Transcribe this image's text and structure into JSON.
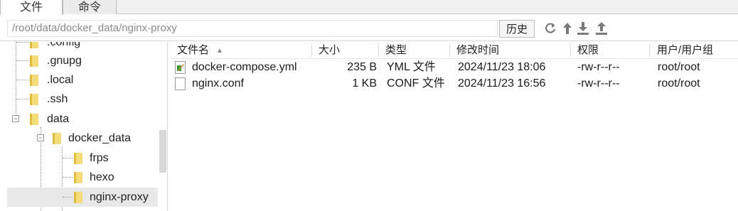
{
  "tabs": [
    {
      "label": "文件",
      "active": true
    },
    {
      "label": "命令",
      "active": false
    }
  ],
  "pathbar": {
    "path": "/root/data/docker_data/nginx-proxy",
    "history_label": "历史"
  },
  "toolbar_icons": [
    "refresh-icon",
    "up-directory-icon",
    "download-icon",
    "upload-icon"
  ],
  "tree": {
    "items": [
      {
        "label": ".config"
      },
      {
        "label": ".gnupg"
      },
      {
        "label": ".local"
      },
      {
        "label": ".ssh"
      },
      {
        "label": "data",
        "expanded": true
      },
      {
        "label": "docker_data",
        "expanded": true
      },
      {
        "label": "frps"
      },
      {
        "label": "hexo"
      },
      {
        "label": "nginx-proxy",
        "selected": true
      }
    ]
  },
  "filelist": {
    "columns": [
      "文件名",
      "大小",
      "类型",
      "修改时间",
      "权限",
      "用户/用户组"
    ],
    "rows": [
      {
        "name": "docker-compose.yml",
        "size": "235 B",
        "type": "YML 文件",
        "modified": "2024/11/23 18:06",
        "perms": "-rw-r--r--",
        "owner": "root/root",
        "icon": "yml-file-icon"
      },
      {
        "name": "nginx.conf",
        "size": "1 KB",
        "type": "CONF 文件",
        "modified": "2024/11/23 16:56",
        "perms": "-rw-r--r--",
        "owner": "root/root",
        "icon": "conf-file-icon"
      }
    ]
  },
  "colors": {
    "folder": "#f4dc7a",
    "selection": "#e8e8e8",
    "path_text": "#8a8a8a"
  }
}
